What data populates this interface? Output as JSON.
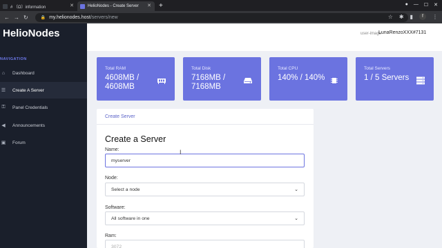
{
  "browser": {
    "tabs": [
      {
        "title": "# 〔Ω〕information",
        "fav_color": "#3b3f46"
      },
      {
        "title": "HelioNodes - Create Server",
        "fav_color": "#6b73e0"
      }
    ],
    "new_tab": "+",
    "url_host": "my.helionodes.host",
    "url_path": "/servers/new",
    "profile_letter": "f"
  },
  "sidebar": {
    "brand": "HelioNodes",
    "nav_label": "NAVIGATION",
    "items": [
      {
        "label": "Dashboard",
        "icon": "home-icon"
      },
      {
        "label": "Create A Server",
        "icon": "server-icon"
      },
      {
        "label": "Panel Credentials",
        "icon": "key-icon"
      },
      {
        "label": "Announcements",
        "icon": "megaphone-icon"
      },
      {
        "label": "Forum",
        "icon": "forum-icon"
      }
    ]
  },
  "header": {
    "user_image_alt": "user-image",
    "username": "LunaRenzoXXX#7131"
  },
  "stats": [
    {
      "label": "Total RAM",
      "value": "4608MB / 4608MB",
      "icon": "memory-icon"
    },
    {
      "label": "Total Disk",
      "value": "7168MB / 7168MB",
      "icon": "disk-icon"
    },
    {
      "label": "Total CPU",
      "value": "140% / 140%",
      "icon": "cpu-icon"
    },
    {
      "label": "Total Servers",
      "value": "1 / 5 Servers",
      "icon": "servers-icon"
    }
  ],
  "form": {
    "panel_title": "Create Server",
    "heading": "Create a Server",
    "name_label": "Name:",
    "name_value": "myserver",
    "node_label": "Node:",
    "node_value": "Select a node",
    "software_label": "Software:",
    "software_value": "All software in one",
    "ram_label": "Ram:",
    "ram_value": "3072"
  },
  "colors": {
    "accent": "#6b73e0",
    "sidebar_bg": "#1a1f2b"
  }
}
